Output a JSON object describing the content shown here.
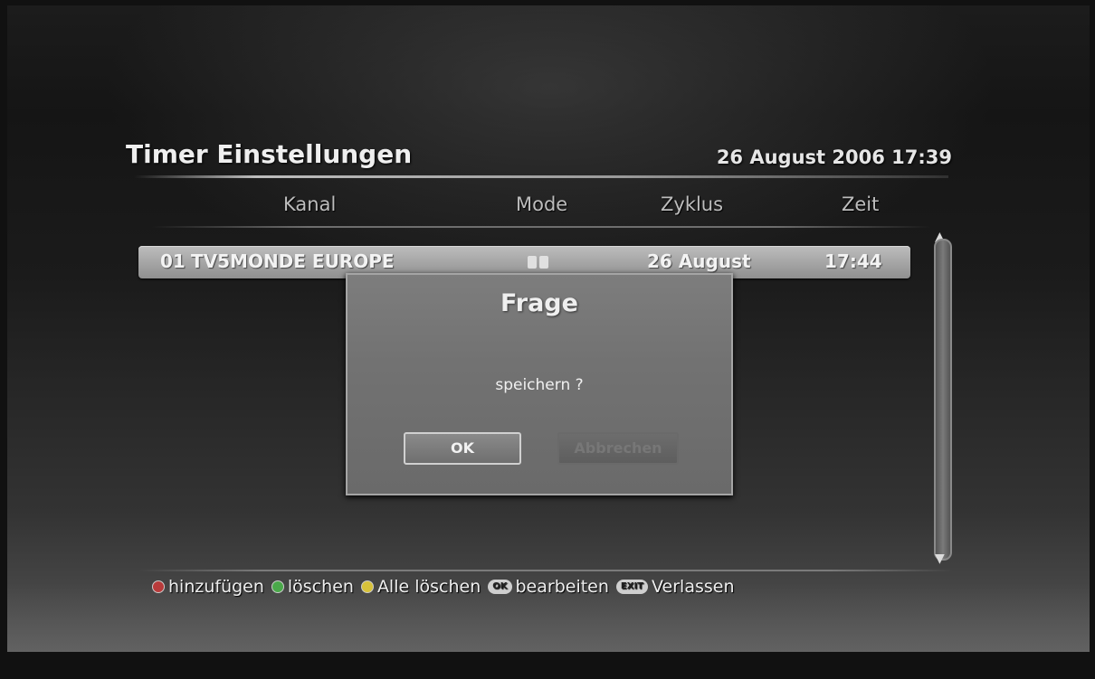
{
  "header": {
    "title": "Timer Einstellungen",
    "datetime": "26 August 2006 17:39"
  },
  "columns": {
    "kanal": "Kanal",
    "mode": "Mode",
    "zyklus": "Zyklus",
    "zeit": "Zeit"
  },
  "timers": [
    {
      "number": "01",
      "channel": "TV5MONDE EUROPE",
      "mode_icons": [
        "speaker-icon",
        "lock-icon"
      ],
      "cycle": "26 August",
      "time": "17:44"
    }
  ],
  "dialog": {
    "title": "Frage",
    "message": "speichern ?",
    "ok_label": "OK",
    "cancel_label": "Abbrechen"
  },
  "legend": {
    "add": {
      "color": "#b83b3b",
      "label": "hinzufügen"
    },
    "delete": {
      "color": "#4aa84a",
      "label": "löschen"
    },
    "delete_all": {
      "color": "#d8c23a",
      "label": "Alle löschen"
    },
    "edit": {
      "key": "OK",
      "label": "bearbeiten"
    },
    "exit": {
      "key": "EXIT",
      "label": "Verlassen"
    }
  }
}
